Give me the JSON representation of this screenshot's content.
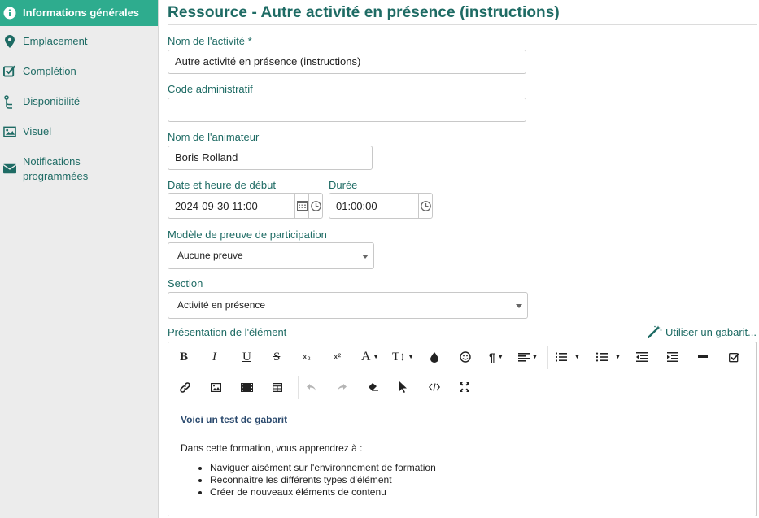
{
  "sidebar": {
    "items": [
      {
        "label": "Informations générales",
        "icon": "info-icon"
      },
      {
        "label": "Emplacement",
        "icon": "map-pin-icon"
      },
      {
        "label": "Complétion",
        "icon": "checkbox-icon"
      },
      {
        "label": "Disponibilité",
        "icon": "branch-icon"
      },
      {
        "label": "Visuel",
        "icon": "image-icon"
      },
      {
        "label": "Notifications",
        "label2": "programmées",
        "icon": "envelope-icon"
      }
    ]
  },
  "page": {
    "title": "Ressource - Autre activité en présence (instructions)"
  },
  "form": {
    "activity_name_label": "Nom de l'activité *",
    "activity_name_value": "Autre activité en présence (instructions)",
    "admin_code_label": "Code administratif",
    "admin_code_value": "",
    "animator_label": "Nom de l'animateur",
    "animator_value": "Boris Rolland",
    "start_label": "Date et heure de début",
    "start_value": "2024-09-30 11:00",
    "duration_label": "Durée",
    "duration_value": "01:00:00",
    "proof_label": "Modèle de preuve de participation",
    "proof_value": "Aucune preuve",
    "section_label": "Section",
    "section_value": "Activité en présence",
    "presentation_label": "Présentation de l'élément",
    "template_link": "Utiliser un gabarit..."
  },
  "editor": {
    "toolbar": {
      "bold": "B",
      "italic": "I",
      "underline": "U",
      "strike": "S",
      "subscript": "x₂",
      "superscript": "x²",
      "font": "A",
      "size": "T↕"
    },
    "content": {
      "heading": "Voici un test de gabarit",
      "paragraph": "Dans cette formation, vous apprendrez à :",
      "bullets": [
        "Naviguer aisément sur l'environnement de formation",
        "Reconnaître les différents types d'élément",
        "Créer de nouveaux éléments de contenu"
      ]
    }
  },
  "colors": {
    "accent": "#2eac8e",
    "teal_text": "#1e6b64",
    "sidebar_bg": "#ececec"
  }
}
